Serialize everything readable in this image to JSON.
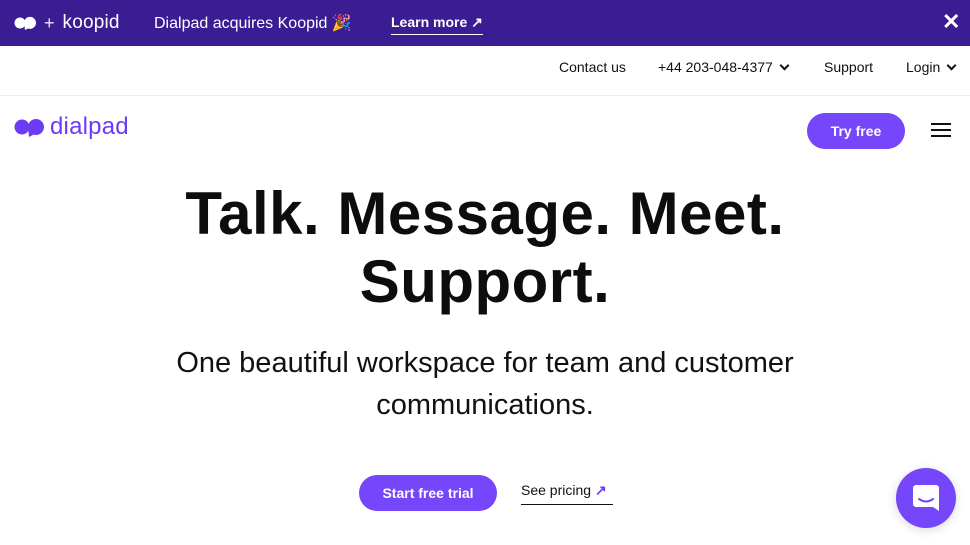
{
  "announcement": {
    "plus": "+",
    "partner_name": "koopid",
    "message": "Dialpad acquires Koopid 🎉",
    "learn_more": "Learn more ↗",
    "close": "✕"
  },
  "utility_nav": {
    "contact": "Contact us",
    "phone": "+44 203-048-4377",
    "support": "Support",
    "login": "Login"
  },
  "nav": {
    "logo_text": "dialpad",
    "try_free": "Try free"
  },
  "hero": {
    "title_line1": "Talk. Message. Meet.",
    "title_line2": "Support.",
    "subtitle_line1": "One beautiful workspace for team and customer",
    "subtitle_line2": "communications.",
    "primary_cta": "Start free trial",
    "secondary_cta": "See pricing",
    "secondary_arrow": "↗"
  },
  "colors": {
    "banner": "#3b1d93",
    "accent": "#7646fa",
    "logo": "#6c3bf5"
  }
}
